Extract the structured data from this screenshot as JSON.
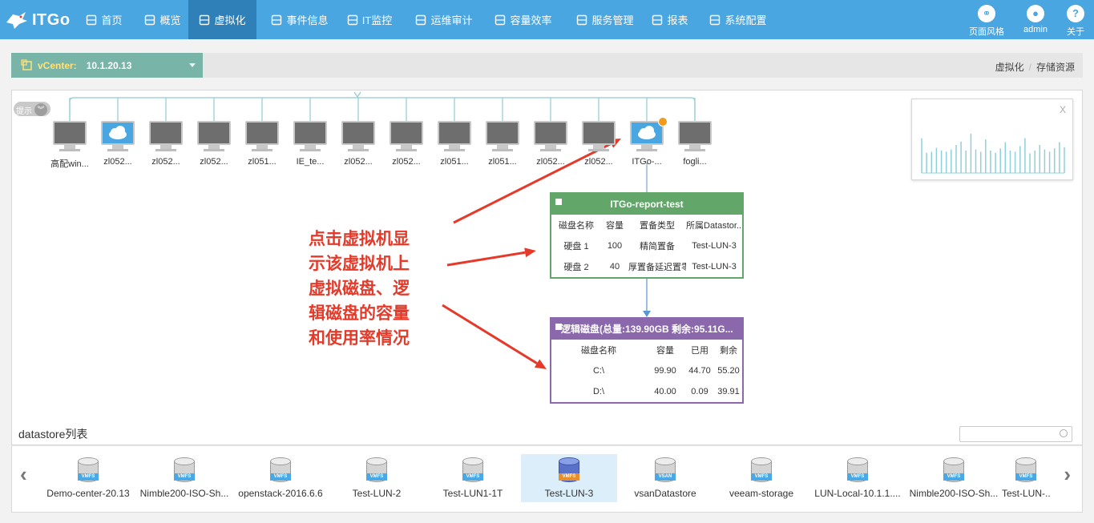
{
  "app": {
    "logo_text": "ITGo"
  },
  "nav": {
    "items": [
      {
        "label": "首页",
        "icon": "home-icon"
      },
      {
        "label": "概览",
        "icon": "grid-icon"
      },
      {
        "label": "虚拟化",
        "icon": "server-icon",
        "active": true
      },
      {
        "label": "事件信息",
        "icon": "document-icon"
      },
      {
        "label": "IT监控",
        "icon": "monitor-icon"
      },
      {
        "label": "运维审计",
        "icon": "chart-icon"
      },
      {
        "label": "容量效率",
        "icon": "storage-icon"
      },
      {
        "label": "服务管理",
        "icon": "network-icon"
      },
      {
        "label": "报表",
        "icon": "pie-icon"
      },
      {
        "label": "系统配置",
        "icon": "gear-icon"
      }
    ],
    "right": [
      {
        "label": "页面风格",
        "icon": "link-icon"
      },
      {
        "label": "admin",
        "icon": "user-icon"
      },
      {
        "label": "关于",
        "icon": "help-icon"
      }
    ]
  },
  "vcenter": {
    "label": "vCenter:",
    "value": "10.1.20.13"
  },
  "breadcrumb": {
    "items": [
      "虚拟化",
      "存储资源"
    ]
  },
  "tip": {
    "label": "提示"
  },
  "vms": [
    {
      "name": "高配win...",
      "type": "gray"
    },
    {
      "name": "zl052...",
      "type": "cloud"
    },
    {
      "name": "zl052...",
      "type": "gray"
    },
    {
      "name": "zl052...",
      "type": "gray"
    },
    {
      "name": "zl051...",
      "type": "gray"
    },
    {
      "name": "IE_te...",
      "type": "gray"
    },
    {
      "name": "zl052...",
      "type": "gray"
    },
    {
      "name": "zl052...",
      "type": "gray"
    },
    {
      "name": "zl051...",
      "type": "gray"
    },
    {
      "name": "zl051...",
      "type": "gray"
    },
    {
      "name": "zl052...",
      "type": "gray"
    },
    {
      "name": "zl052...",
      "type": "gray"
    },
    {
      "name": "ITGo-...",
      "type": "cloud",
      "badge": true
    },
    {
      "name": "fogli...",
      "type": "gray"
    }
  ],
  "vm_disk_table": {
    "title": "ITGo-report-test",
    "headers": [
      "磁盘名称",
      "容量",
      "置备类型",
      "所属Datastor..."
    ],
    "rows": [
      [
        "硬盘 1",
        "100",
        "精简置备",
        "Test-LUN-3"
      ],
      [
        "硬盘 2",
        "40",
        "厚置备延迟置零",
        "Test-LUN-3"
      ]
    ]
  },
  "logical_disk_table": {
    "title": "逻辑磁盘(总量:139.90GB 剩余:95.11G...",
    "headers": [
      "磁盘名称",
      "容量",
      "已用",
      "剩余"
    ],
    "rows": [
      [
        "C:\\",
        "99.90",
        "44.70",
        "55.20"
      ],
      [
        "D:\\",
        "40.00",
        "0.09",
        "39.91"
      ]
    ]
  },
  "annotation": {
    "lines": [
      "点击虚拟机显",
      "示该虚拟机上",
      "虚拟磁盘、逻",
      "辑磁盘的容量",
      "和使用率情况"
    ],
    "color": "#e53a2a"
  },
  "mini_chart": {
    "close_label": "X",
    "values": [
      0.62,
      0.36,
      0.38,
      0.45,
      0.4,
      0.38,
      0.42,
      0.5,
      0.56,
      0.4,
      0.7,
      0.42,
      0.38,
      0.6,
      0.4,
      0.36,
      0.44,
      0.55,
      0.4,
      0.38,
      0.48,
      0.62,
      0.35,
      0.4,
      0.5,
      0.42,
      0.38,
      0.44,
      0.55,
      0.46
    ]
  },
  "datastore": {
    "title": "datastore列表",
    "search_placeholder": "",
    "items": [
      {
        "name": "Demo-center-20.13",
        "tag": "VMFS"
      },
      {
        "name": "Nimble200-ISO-Sh...",
        "tag": "VMFS"
      },
      {
        "name": "openstack-2016.6.6",
        "tag": "VMFS"
      },
      {
        "name": "Test-LUN-2",
        "tag": "VMFS"
      },
      {
        "name": "Test-LUN1-1T",
        "tag": "VMFS"
      },
      {
        "name": "Test-LUN-3",
        "tag": "VMFS",
        "selected": true
      },
      {
        "name": "vsanDatastore",
        "tag": "VSAN"
      },
      {
        "name": "veeam-storage",
        "tag": "VMFS"
      },
      {
        "name": "LUN-Local-10.1.1....",
        "tag": "VMFS"
      },
      {
        "name": "Nimble200-ISO-Sh...",
        "tag": "VMFS"
      },
      {
        "name": "Test-LUN-...",
        "tag": "VMFS"
      }
    ],
    "prev_label": "‹",
    "next_label": "›"
  }
}
